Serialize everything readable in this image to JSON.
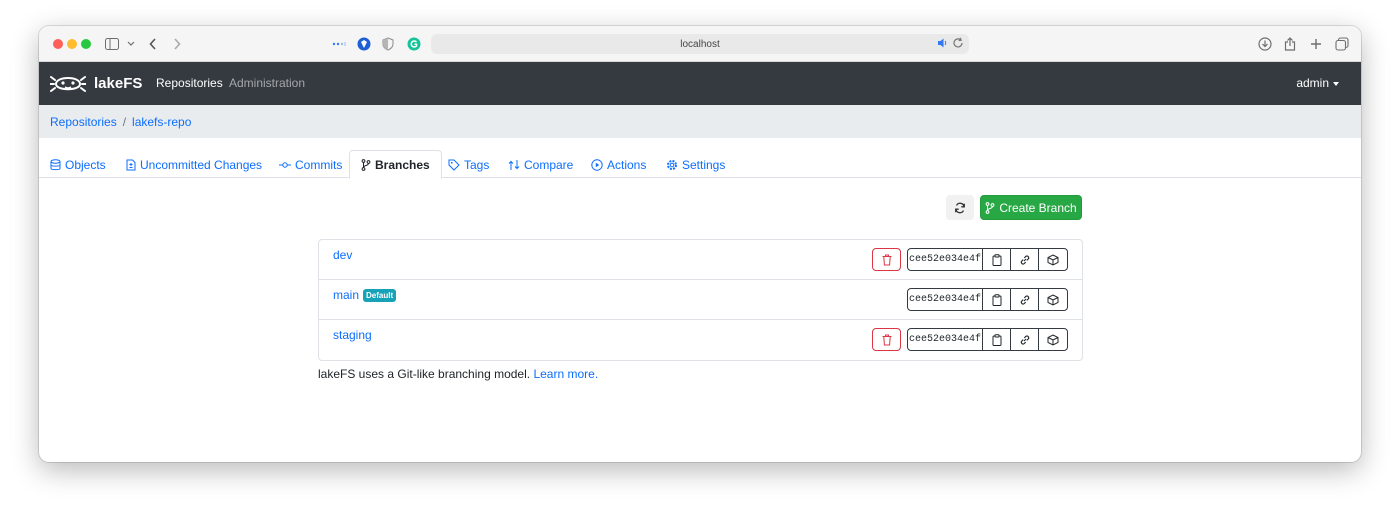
{
  "browser": {
    "url": "localhost"
  },
  "navbar": {
    "brand": "lakeFS",
    "links": [
      "Repositories",
      "Administration"
    ],
    "user": "admin"
  },
  "breadcrumb": {
    "items": [
      "Repositories",
      "lakefs-repo"
    ],
    "separator": "/"
  },
  "tabs": [
    {
      "label": "Objects",
      "icon": "database-icon"
    },
    {
      "label": "Uncommitted Changes",
      "icon": "file-diff-icon"
    },
    {
      "label": "Commits",
      "icon": "commit-icon"
    },
    {
      "label": "Branches",
      "icon": "git-branch-icon",
      "active": true
    },
    {
      "label": "Tags",
      "icon": "tag-icon"
    },
    {
      "label": "Compare",
      "icon": "compare-arrows-icon"
    },
    {
      "label": "Actions",
      "icon": "play-circle-icon"
    },
    {
      "label": "Settings",
      "icon": "gear-icon"
    }
  ],
  "actions": {
    "create_branch": "Create Branch"
  },
  "branches": [
    {
      "name": "dev",
      "commit": "cee52e034e4f",
      "deletable": true
    },
    {
      "name": "main",
      "badge": "Default",
      "commit": "cee52e034e4f",
      "deletable": false
    },
    {
      "name": "staging",
      "commit": "cee52e034e4f",
      "deletable": true
    }
  ],
  "footer": {
    "text": "lakeFS uses a Git-like branching model.",
    "link": "Learn more."
  },
  "colors": {
    "navbar": "#343a40",
    "link": "#0d6efd",
    "create_button": "#28a745",
    "delete": "#dc3545",
    "badge": "#17a2b8"
  }
}
